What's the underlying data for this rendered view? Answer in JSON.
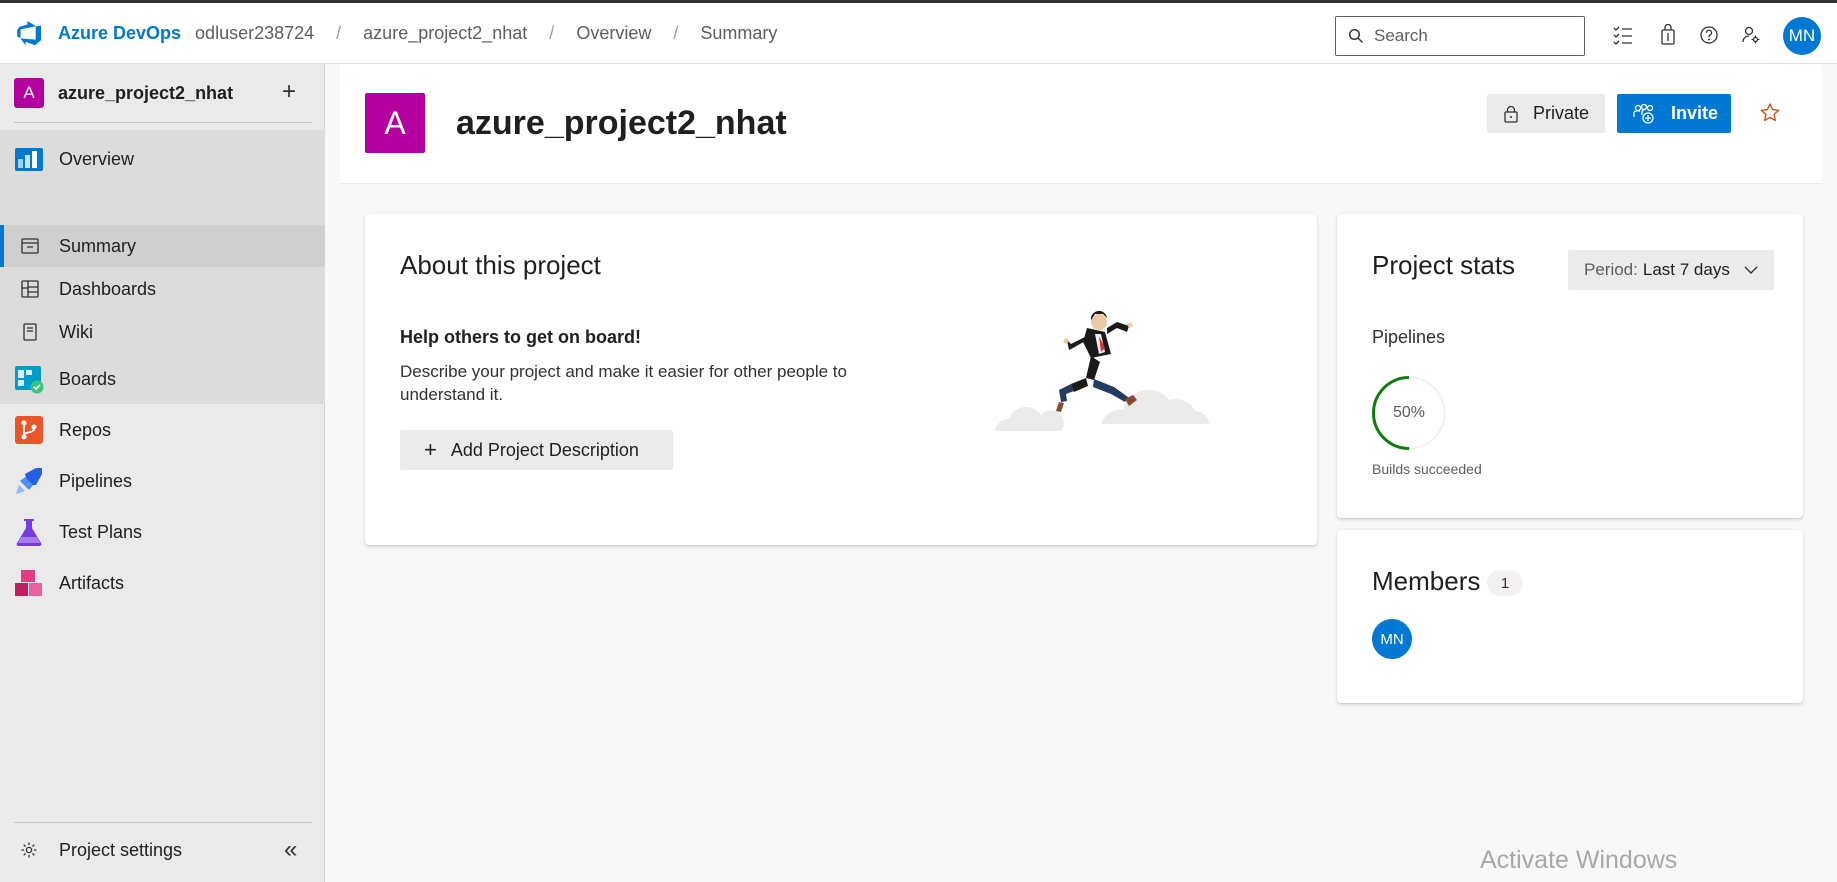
{
  "header": {
    "brand": "Azure DevOps",
    "breadcrumbs": [
      "odluser238724",
      "azure_project2_nhat",
      "Overview",
      "Summary"
    ],
    "separator": "/",
    "search_placeholder": "Search",
    "user_initials": "MN",
    "icons": [
      "task-list-icon",
      "marketplace-icon",
      "help-icon",
      "user-settings-icon"
    ]
  },
  "sidebar": {
    "project_initial": "A",
    "project_name": "azure_project2_nhat",
    "add_symbol": "+",
    "overview": "Overview",
    "sub_items": [
      "Summary",
      "Dashboards",
      "Wiki"
    ],
    "items": [
      "Boards",
      "Repos",
      "Pipelines",
      "Test Plans",
      "Artifacts"
    ],
    "settings": "Project settings",
    "collapse_symbol": "«"
  },
  "main": {
    "project_initial": "A",
    "project_title": "azure_project2_nhat",
    "private_label": "Private",
    "invite_label": "Invite"
  },
  "about": {
    "title": "About this project",
    "help_title": "Help others to get on board!",
    "help_desc": "Describe your project and make it easier for other people to understand it.",
    "add_button": "Add Project Description",
    "add_symbol": "+"
  },
  "stats": {
    "title": "Project stats",
    "period_label": "Period:",
    "period_value": "Last 7 days",
    "pipelines_label": "Pipelines",
    "success_percent": "50%",
    "success_fraction": 0.5,
    "builds_label": "Builds succeeded"
  },
  "members": {
    "title": "Members",
    "count": "1",
    "avatar_initials": "MN"
  },
  "watermark": "Activate Windows",
  "colors": {
    "accent": "#0078d4",
    "project": "#b4009e",
    "success": "#107c10"
  }
}
